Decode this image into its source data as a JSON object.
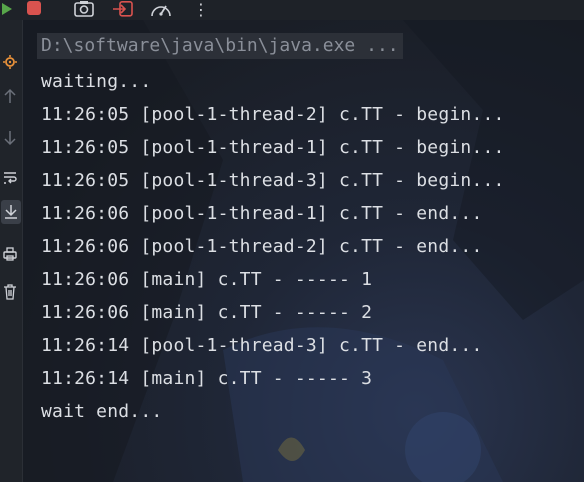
{
  "toolbar": {
    "icons": [
      "run-icon",
      "stop-icon",
      "screenshot-icon",
      "exit-icon",
      "dashboard-icon",
      "more-icon"
    ],
    "more_label": "⋮",
    "colors": {
      "run": "#57a64a",
      "stop": "#d9534f",
      "icon": "#cfd2d8"
    }
  },
  "gutter": {
    "icons": [
      "settings-icon",
      "arrow-up-icon",
      "arrow-down-icon",
      "soft-wrap-icon",
      "scroll-to-end-icon",
      "print-icon",
      "trash-icon"
    ]
  },
  "console": {
    "command": "D:\\software\\java\\bin\\java.exe ...",
    "lines": [
      "waiting...",
      "11:26:05 [pool-1-thread-2] c.TT - begin...",
      "11:26:05 [pool-1-thread-1] c.TT - begin...",
      "11:26:05 [pool-1-thread-3] c.TT - begin...",
      "11:26:06 [pool-1-thread-1] c.TT - end...",
      "11:26:06 [pool-1-thread-2] c.TT - end...",
      "11:26:06 [main] c.TT - ----- 1",
      "11:26:06 [main] c.TT - ----- 2",
      "11:26:14 [pool-1-thread-3] c.TT - end...",
      "11:26:14 [main] c.TT - ----- 3",
      "wait end..."
    ],
    "colors": {
      "text": "#dcdfe4",
      "command_text": "#8a8f99",
      "command_bg": "#2c3038"
    }
  }
}
